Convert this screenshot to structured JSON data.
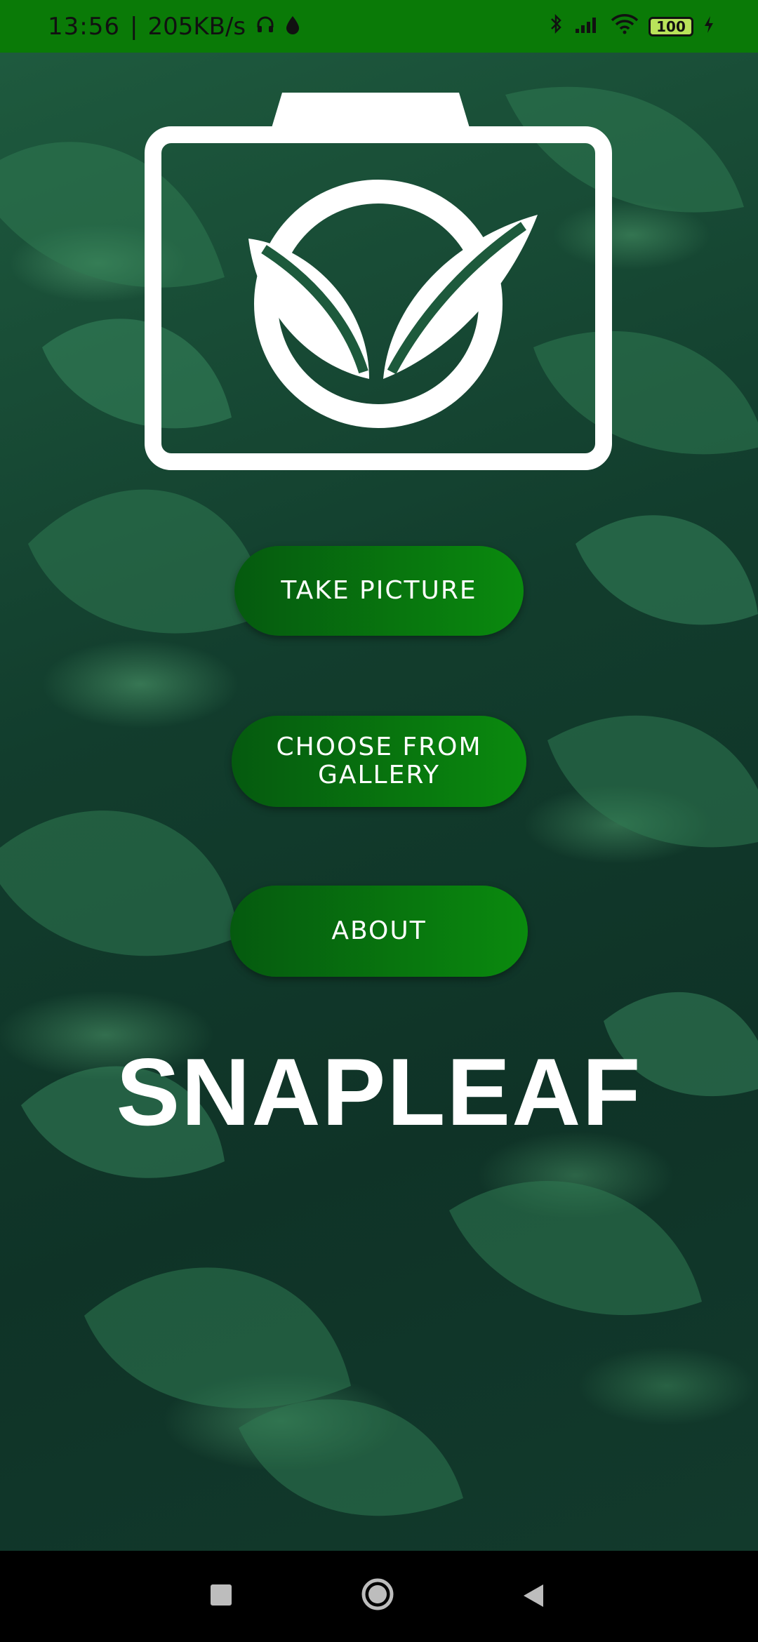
{
  "status_bar": {
    "time": "13:56",
    "network_speed": "205KB/s",
    "battery_level": "100",
    "icons": [
      "headphones-icon",
      "drop-icon",
      "bluetooth-icon",
      "signal-icon",
      "wifi-icon",
      "battery-icon",
      "charging-icon"
    ]
  },
  "logo": {
    "icon": "camera-leaf-icon"
  },
  "buttons": {
    "take_picture": "TAKE PICTURE",
    "choose_gallery_line1": "CHOOSE FROM",
    "choose_gallery_line2": "GALLERY",
    "about": "ABOUT"
  },
  "app": {
    "title": "SNAPLEAF"
  },
  "nav_bar": {
    "icons": [
      "recents-icon",
      "home-icon",
      "back-icon"
    ]
  },
  "colors": {
    "status_bar": "#0a7a07",
    "button_start": "#055a0f",
    "button_end": "#0a8a0e",
    "background": "#123d2d",
    "text": "#ffffff"
  }
}
